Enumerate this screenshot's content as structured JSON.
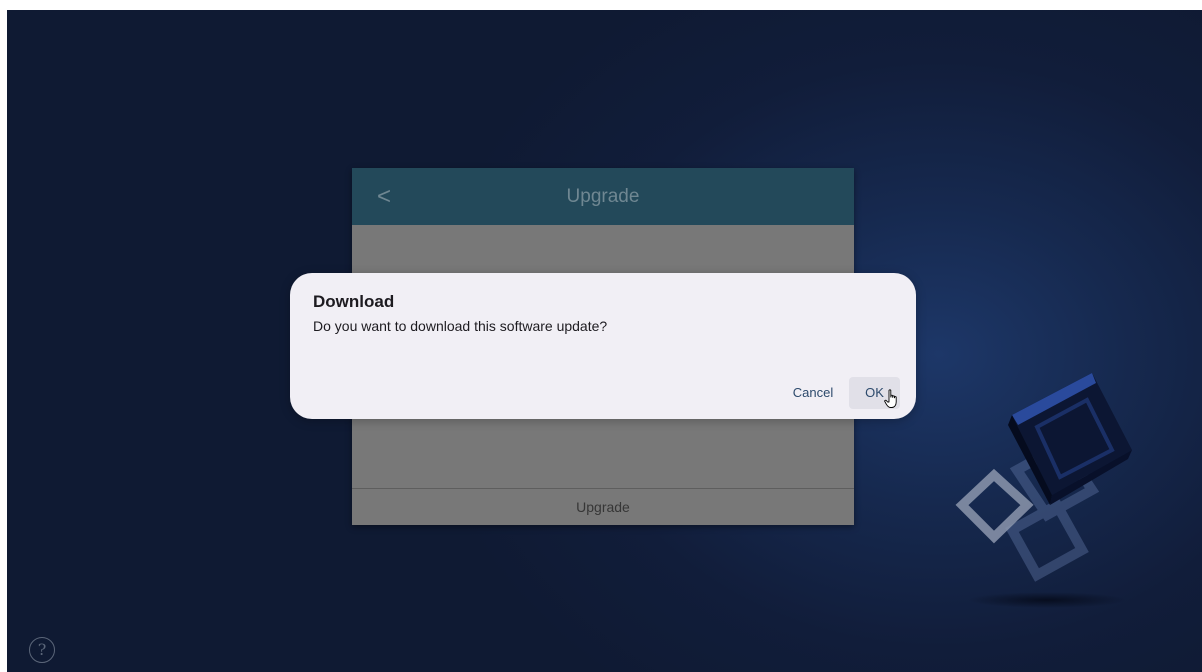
{
  "panel": {
    "back_glyph": "<",
    "title": "Upgrade",
    "footer_label": "Upgrade"
  },
  "dialog": {
    "title": "Download",
    "message": "Do you want to download this software update?",
    "cancel_label": "Cancel",
    "ok_label": "OK"
  },
  "help": {
    "glyph": "?"
  },
  "icons": {
    "back": "chevron-left-icon",
    "help": "question-circle-icon",
    "cursor": "hand-pointer-icon"
  },
  "colors": {
    "background": "#111d3a",
    "panel_header": "#23495a",
    "dialog_bg": "#f1eff5",
    "button_text": "#2d4a6c"
  }
}
